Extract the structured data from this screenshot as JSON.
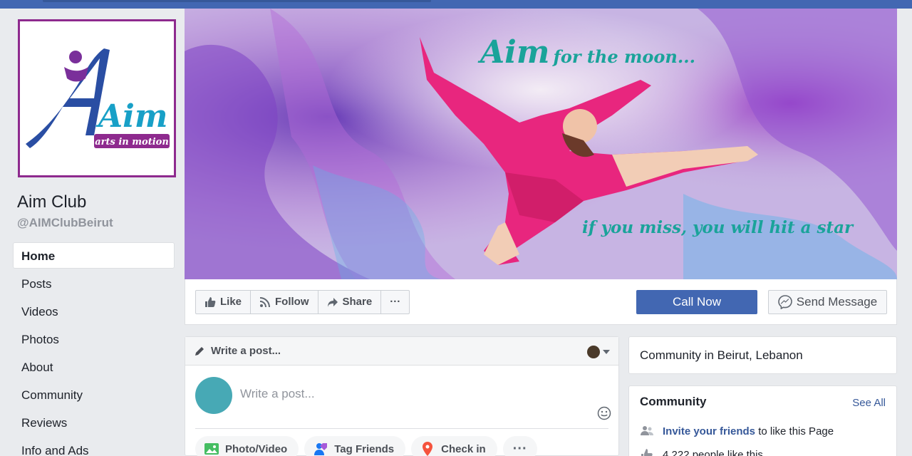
{
  "page": {
    "name": "Aim Club",
    "handle": "@AIMClubBeirut",
    "logo": {
      "word": "Aim",
      "tagline": "arts in motion"
    }
  },
  "nav": {
    "items": [
      {
        "label": "Home"
      },
      {
        "label": "Posts"
      },
      {
        "label": "Videos"
      },
      {
        "label": "Photos"
      },
      {
        "label": "About"
      },
      {
        "label": "Community"
      },
      {
        "label": "Reviews"
      },
      {
        "label": "Info and Ads"
      }
    ]
  },
  "cover": {
    "headline_big": "Aim",
    "headline_small": "for the moon...",
    "tagline": "if you miss, you will hit a star"
  },
  "actions": {
    "like": "Like",
    "follow": "Follow",
    "share": "Share",
    "more": "···",
    "call_now": "Call Now",
    "send_message": "Send Message"
  },
  "composer": {
    "header": "Write a post...",
    "placeholder": "Write a post...",
    "buttons": [
      {
        "label": "Photo/Video"
      },
      {
        "label": "Tag Friends"
      },
      {
        "label": "Check in"
      }
    ],
    "more": "···"
  },
  "sidebar_right": {
    "about_line": "Community in Beirut, Lebanon",
    "community": {
      "title": "Community",
      "see_all": "See All",
      "invite_link": "Invite your friends",
      "invite_rest": " to like this Page",
      "likes": "4,222 people like this"
    }
  },
  "colors": {
    "brand_blue": "#4267b2",
    "link_blue": "#365899",
    "logo_purple": "#8e2a8e",
    "cover_teal": "#1aa39a",
    "avatar_teal": "#47a9b5"
  }
}
